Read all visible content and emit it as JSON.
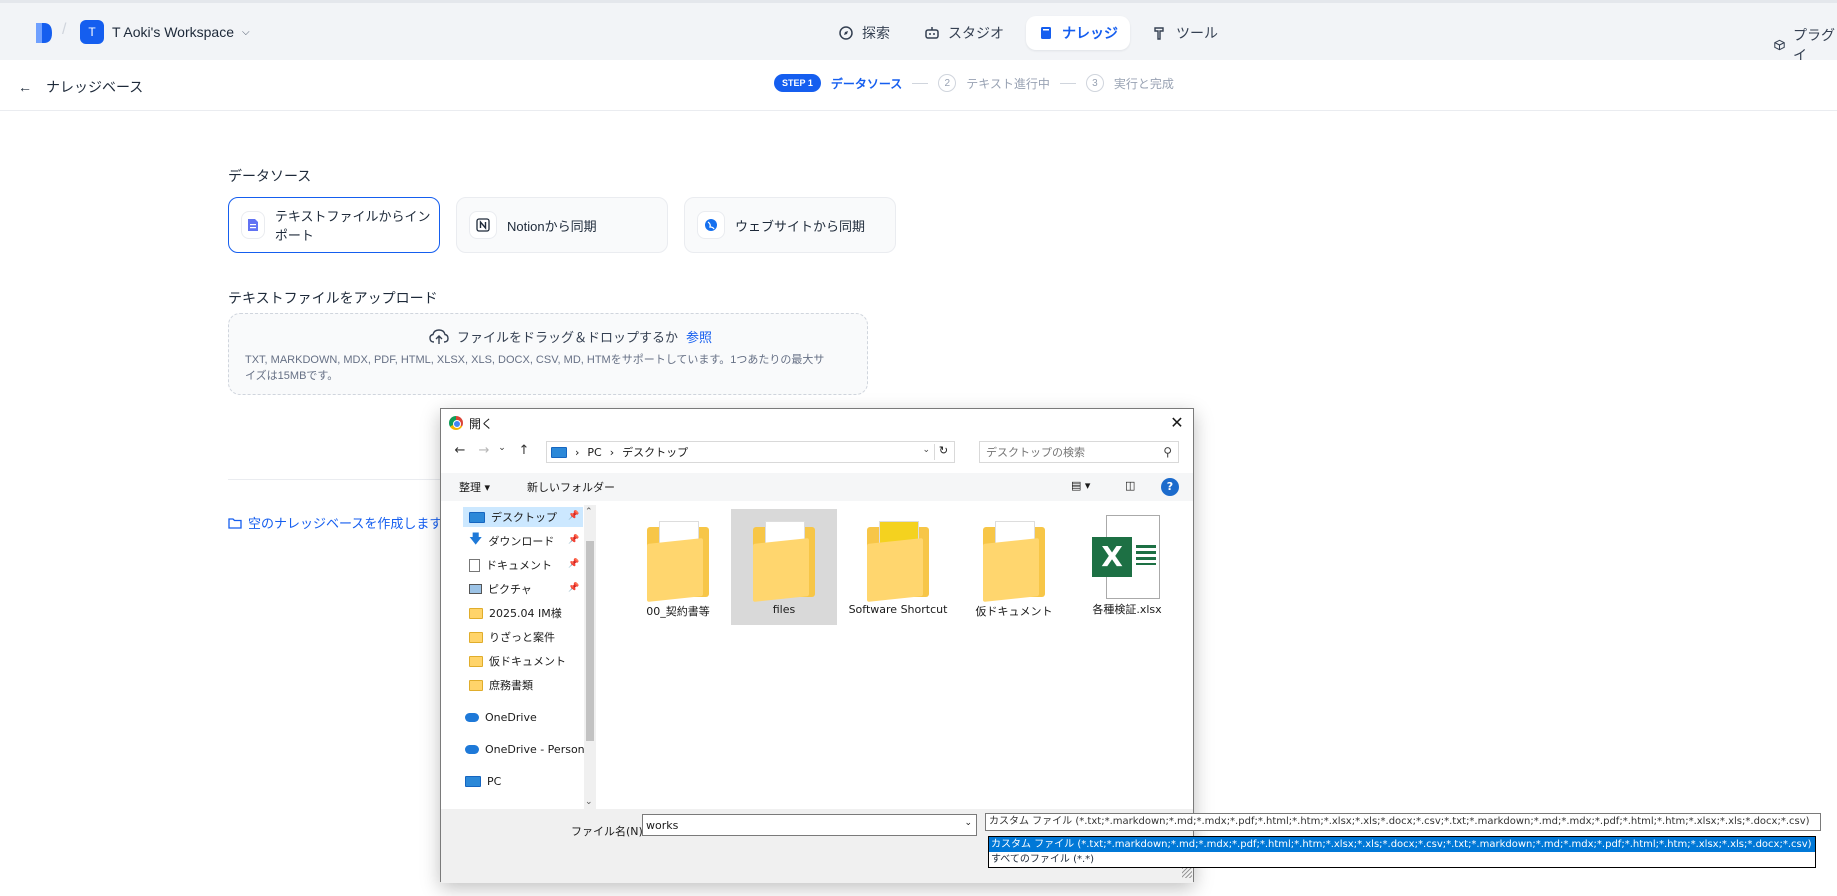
{
  "topbar": {
    "workspace_avatar": "T",
    "workspace_name": "T Aoki's Workspace",
    "nav": [
      {
        "label": "探索",
        "icon": "compass-icon"
      },
      {
        "label": "スタジオ",
        "icon": "robot-icon"
      },
      {
        "label": "ナレッジ",
        "icon": "book-icon",
        "active": true
      },
      {
        "label": "ツール",
        "icon": "hammer-icon"
      }
    ],
    "plugin_label": "プラグイ"
  },
  "subheader": {
    "back_label": "ナレッジベース",
    "steps": {
      "step1_badge": "STEP 1",
      "step1_label": "データソース",
      "step2_num": "2",
      "step2_label": "テキスト進行中",
      "step3_num": "3",
      "step3_label": "実行と完成"
    }
  },
  "main": {
    "datasource_title": "データソース",
    "sources": [
      {
        "label": "テキストファイルからインポート",
        "icon": "document-icon",
        "selected": true
      },
      {
        "label": "Notionから同期",
        "icon": "notion-icon"
      },
      {
        "label": "ウェブサイトから同期",
        "icon": "globe-icon"
      }
    ],
    "upload_title": "テキストファイルをアップロード",
    "upload_drag_text": "ファイルをドラッグ＆ドロップするか",
    "upload_browse": "参照",
    "upload_hint": "TXT, MARKDOWN, MDX, PDF, HTML, XLSX, XLS, DOCX, CSV, MD, HTMをサポートしています。1つあたりの最大サイズは15MBです。",
    "create_empty": "空のナレッジベースを作成します"
  },
  "dialog": {
    "title": "開く",
    "address": {
      "pc": "PC",
      "folder": "デスクトップ"
    },
    "search_placeholder": "デスクトップの検索",
    "toolbar": {
      "organize": "整理 ▾",
      "new_folder": "新しいフォルダー",
      "help": "?"
    },
    "tree": [
      {
        "label": "デスクトップ",
        "pinned": true,
        "selected": true
      },
      {
        "label": "ダウンロード",
        "pinned": true
      },
      {
        "label": "ドキュメント",
        "pinned": true
      },
      {
        "label": "ピクチャ",
        "pinned": true
      },
      {
        "label": "2025.04 IM様"
      },
      {
        "label": "りざっと案件"
      },
      {
        "label": "仮ドキュメント"
      },
      {
        "label": "庶務書類"
      },
      {
        "label": "OneDrive"
      },
      {
        "label": "OneDrive - Person"
      },
      {
        "label": "PC"
      }
    ],
    "files": [
      {
        "name": "00_契約書等",
        "type": "folder"
      },
      {
        "name": "files",
        "type": "folder",
        "selected": true
      },
      {
        "name": "Software Shortcut",
        "type": "folder"
      },
      {
        "name": "仮ドキュメント",
        "type": "folder"
      },
      {
        "name": "各種検証.xlsx",
        "type": "excel"
      }
    ],
    "filename_label": "ファイル名(N):",
    "filename_value": "works",
    "filter_current": "カスタム ファイル (*.txt;*.markdown;*.md;*.mdx;*.pdf;*.html;*.htm;*.xlsx;*.xls;*.docx;*.csv;*.txt;*.markdown;*.md;*.mdx;*.pdf;*.html;*.htm;*.xlsx;*.xls;*.docx;*.csv)",
    "filter_options": [
      "カスタム ファイル (*.txt;*.markdown;*.md;*.mdx;*.pdf;*.html;*.htm;*.xlsx;*.xls;*.docx;*.csv;*.txt;*.markdown;*.md;*.mdx;*.pdf;*.html;*.htm;*.xlsx;*.xls;*.docx;*.csv)",
      "すべてのファイル (*.*)"
    ]
  },
  "colors": {
    "accent": "#155eef",
    "win_select": "#0078d7"
  }
}
